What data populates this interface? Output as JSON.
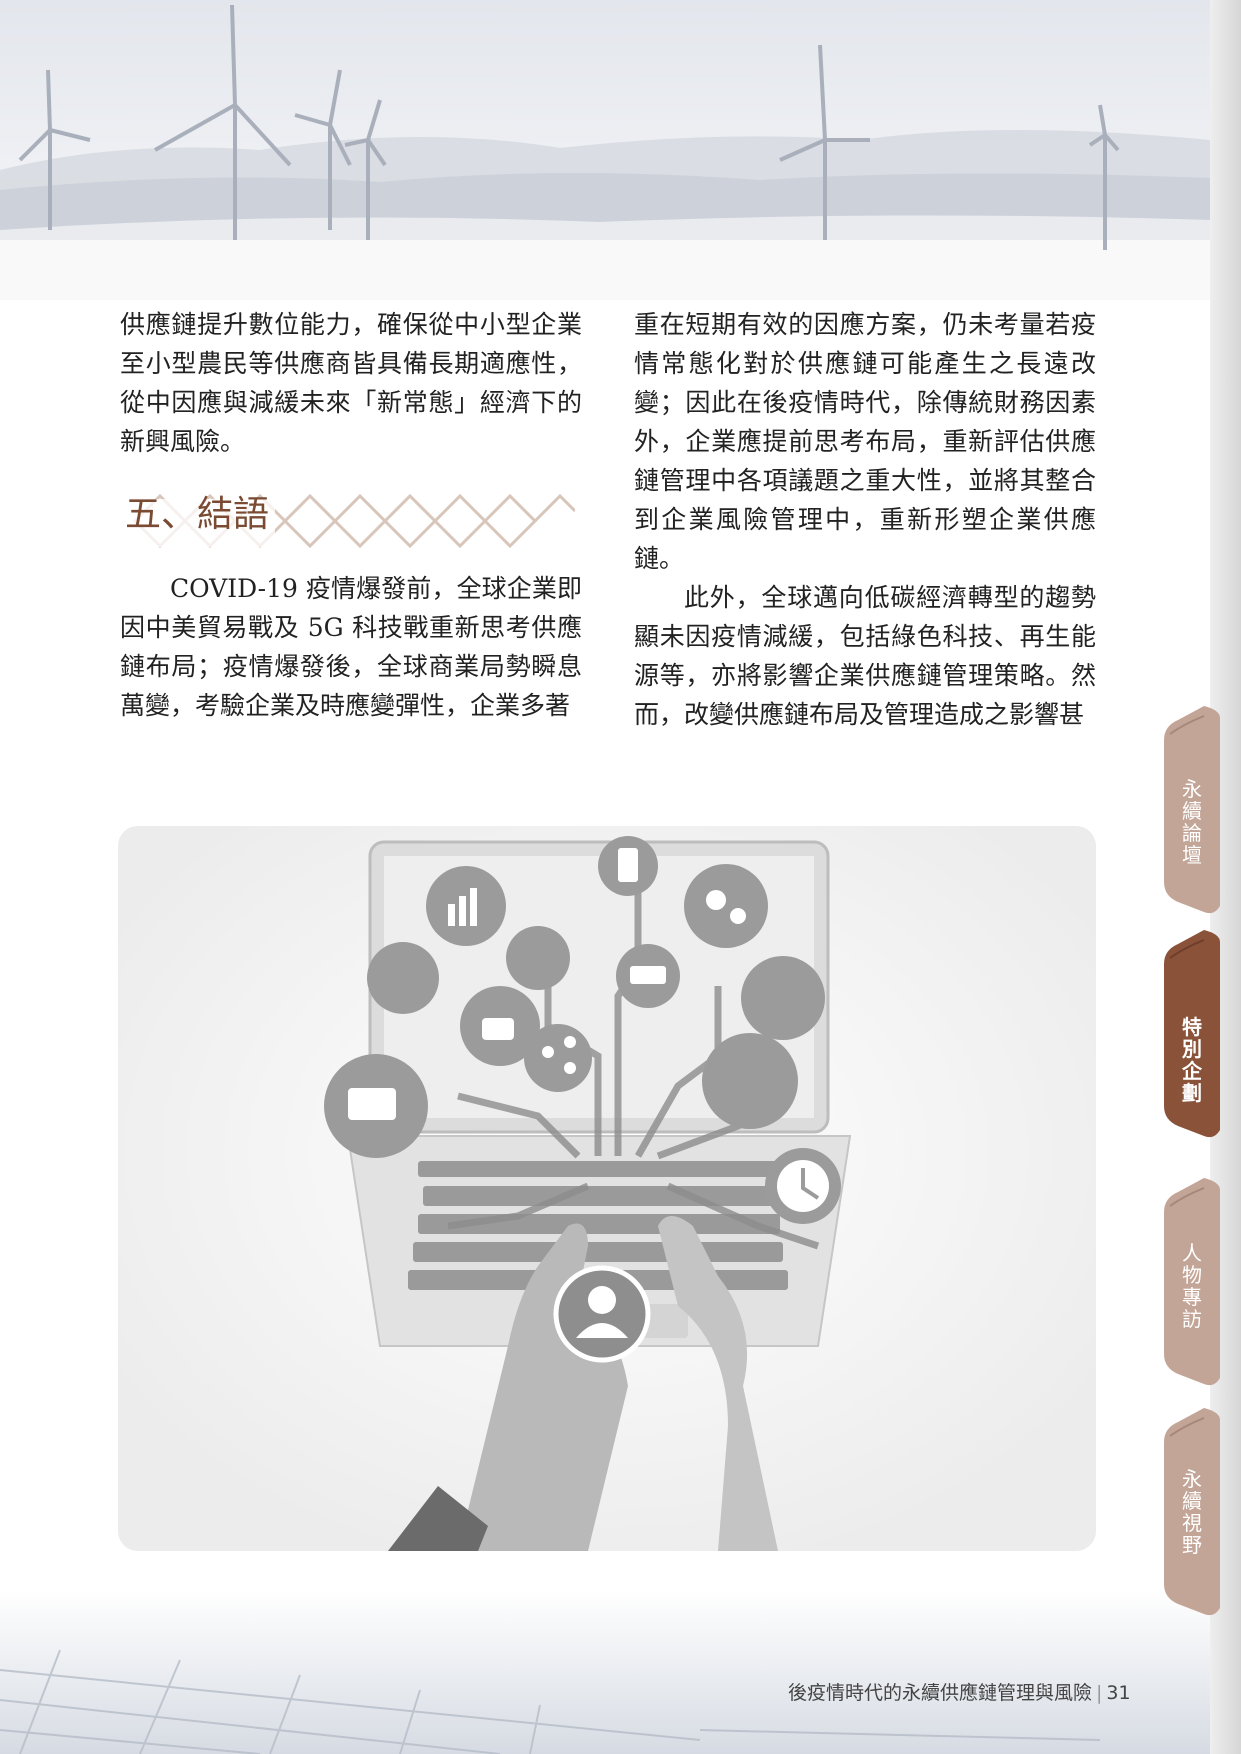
{
  "left_column": {
    "para1": "供應鏈提升數位能力，確保從中小型企業至小型農民等供應商皆具備長期適應性，從中因應與減緩未來「新常態」經濟下的新興風險。",
    "heading": "五、結語",
    "para2": "COVID-19 疫情爆發前，全球企業即因中美貿易戰及 5G 科技戰重新思考供應鏈布局；疫情爆發後，全球商業局勢瞬息萬變，考驗企業及時應變彈性，企業多著"
  },
  "right_column": {
    "para1": "重在短期有效的因應方案，仍未考量若疫情常態化對於供應鏈可能產生之長遠改變；因此在後疫情時代，除傳統財務因素外，企業應提前思考布局，重新評估供應鏈管理中各項議題之重大性，並將其整合到企業風險管理中，重新形塑企業供應鏈。",
    "para2": "此外，全球邁向低碳經濟轉型的趨勢顯未因疫情減緩，包括綠色科技、再生能源等，亦將影響企業供應鏈管理策略。然而，改變供應鏈布局及管理造成之影響甚"
  },
  "side_tabs": [
    {
      "label": "永續論壇",
      "active": false
    },
    {
      "label": "特別企劃",
      "active": true
    },
    {
      "label": "人物專訪",
      "active": false
    },
    {
      "label": "永續視野",
      "active": false
    }
  ],
  "footer": {
    "title": "後疫情時代的永續供應鏈管理與風險",
    "separator": "|",
    "page_number": "31"
  },
  "colors": {
    "heading": "#7a4a32",
    "tab_inactive": "#c3a597",
    "tab_active": "#8a5239"
  }
}
